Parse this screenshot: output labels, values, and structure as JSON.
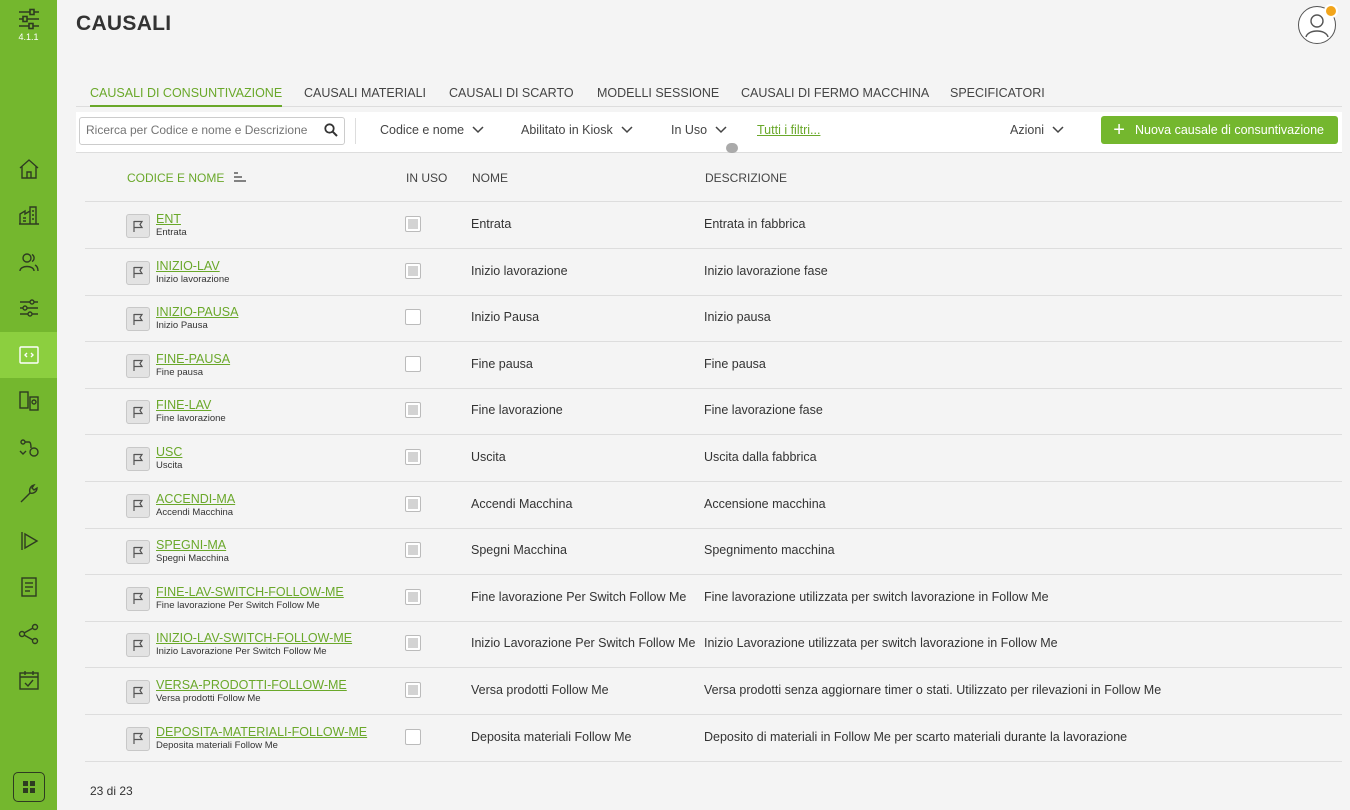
{
  "app": {
    "version": "4.1.1",
    "page_title": "CAUSALI",
    "accent_color": "#74b72e"
  },
  "sidebar": {
    "items": [
      {
        "icon": "home-icon"
      },
      {
        "icon": "factory-icon"
      },
      {
        "icon": "users-icon"
      },
      {
        "icon": "sliders-icon"
      },
      {
        "icon": "code-window-icon",
        "active": true
      },
      {
        "icon": "devices-icon"
      },
      {
        "icon": "workflow-icon"
      },
      {
        "icon": "wrench-icon"
      },
      {
        "icon": "play-icon"
      },
      {
        "icon": "document-icon"
      },
      {
        "icon": "share-icon"
      },
      {
        "icon": "calendar-check-icon"
      }
    ]
  },
  "tabs": [
    {
      "label": "CAUSALI DI CONSUNTIVAZIONE",
      "active": true
    },
    {
      "label": "CAUSALI MATERIALI"
    },
    {
      "label": "CAUSALI DI SCARTO"
    },
    {
      "label": "MODELLI SESSIONE"
    },
    {
      "label": "CAUSALI DI FERMO MACCHINA"
    },
    {
      "label": "SPECIFICATORI"
    }
  ],
  "toolbar": {
    "search_placeholder": "Ricerca per Codice e nome e Descrizione",
    "filter_code": "Codice e nome",
    "filter_kiosk": "Abilitato in Kiosk",
    "filter_inuse": "In Uso",
    "all_filters": "Tutti i filtri...",
    "actions": "Azioni",
    "new_button": "Nuova causale di consuntivazione"
  },
  "table": {
    "headers": {
      "code": "CODICE E NOME",
      "in_use": "IN USO",
      "name": "NOME",
      "description": "DESCRIZIONE"
    },
    "rows": [
      {
        "code": "ENT",
        "sub": "Entrata",
        "in_use": true,
        "name": "Entrata",
        "description": "Entrata in fabbrica"
      },
      {
        "code": "INIZIO-LAV",
        "sub": "Inizio lavorazione",
        "in_use": true,
        "name": "Inizio lavorazione",
        "description": "Inizio lavorazione fase"
      },
      {
        "code": "INIZIO-PAUSA",
        "sub": "Inizio Pausa",
        "in_use": false,
        "name": "Inizio Pausa",
        "description": "Inizio pausa"
      },
      {
        "code": "FINE-PAUSA",
        "sub": "Fine pausa",
        "in_use": false,
        "name": "Fine pausa",
        "description": "Fine pausa"
      },
      {
        "code": "FINE-LAV",
        "sub": "Fine lavorazione",
        "in_use": true,
        "name": "Fine lavorazione",
        "description": "Fine lavorazione fase"
      },
      {
        "code": "USC",
        "sub": "Uscita",
        "in_use": true,
        "name": "Uscita",
        "description": "Uscita dalla fabbrica"
      },
      {
        "code": "ACCENDI-MA",
        "sub": "Accendi Macchina",
        "in_use": true,
        "name": "Accendi Macchina",
        "description": "Accensione macchina"
      },
      {
        "code": "SPEGNI-MA",
        "sub": "Spegni Macchina",
        "in_use": true,
        "name": "Spegni Macchina",
        "description": "Spegnimento macchina"
      },
      {
        "code": "FINE-LAV-SWITCH-FOLLOW-ME",
        "sub": "Fine lavorazione Per Switch Follow Me",
        "in_use": true,
        "name": "Fine lavorazione Per Switch Follow Me",
        "description": "Fine lavorazione utilizzata per switch lavorazione in Follow Me"
      },
      {
        "code": "INIZIO-LAV-SWITCH-FOLLOW-ME",
        "sub": "Inizio Lavorazione Per Switch Follow Me",
        "in_use": true,
        "name": "Inizio Lavorazione Per Switch Follow Me",
        "description": "Inizio Lavorazione utilizzata per switch lavorazione in Follow Me"
      },
      {
        "code": "VERSA-PRODOTTI-FOLLOW-ME",
        "sub": "Versa prodotti Follow Me",
        "in_use": true,
        "name": "Versa prodotti Follow Me",
        "description": "Versa prodotti senza aggiornare timer o stati. Utilizzato per rilevazioni in Follow Me"
      },
      {
        "code": "DEPOSITA-MATERIALI-FOLLOW-ME",
        "sub": "Deposita materiali Follow Me",
        "in_use": false,
        "name": "Deposita materiali Follow Me",
        "description": "Deposito di materiali in Follow Me per scarto materiali durante la lavorazione"
      }
    ]
  },
  "footer": {
    "count": "23 di 23"
  }
}
